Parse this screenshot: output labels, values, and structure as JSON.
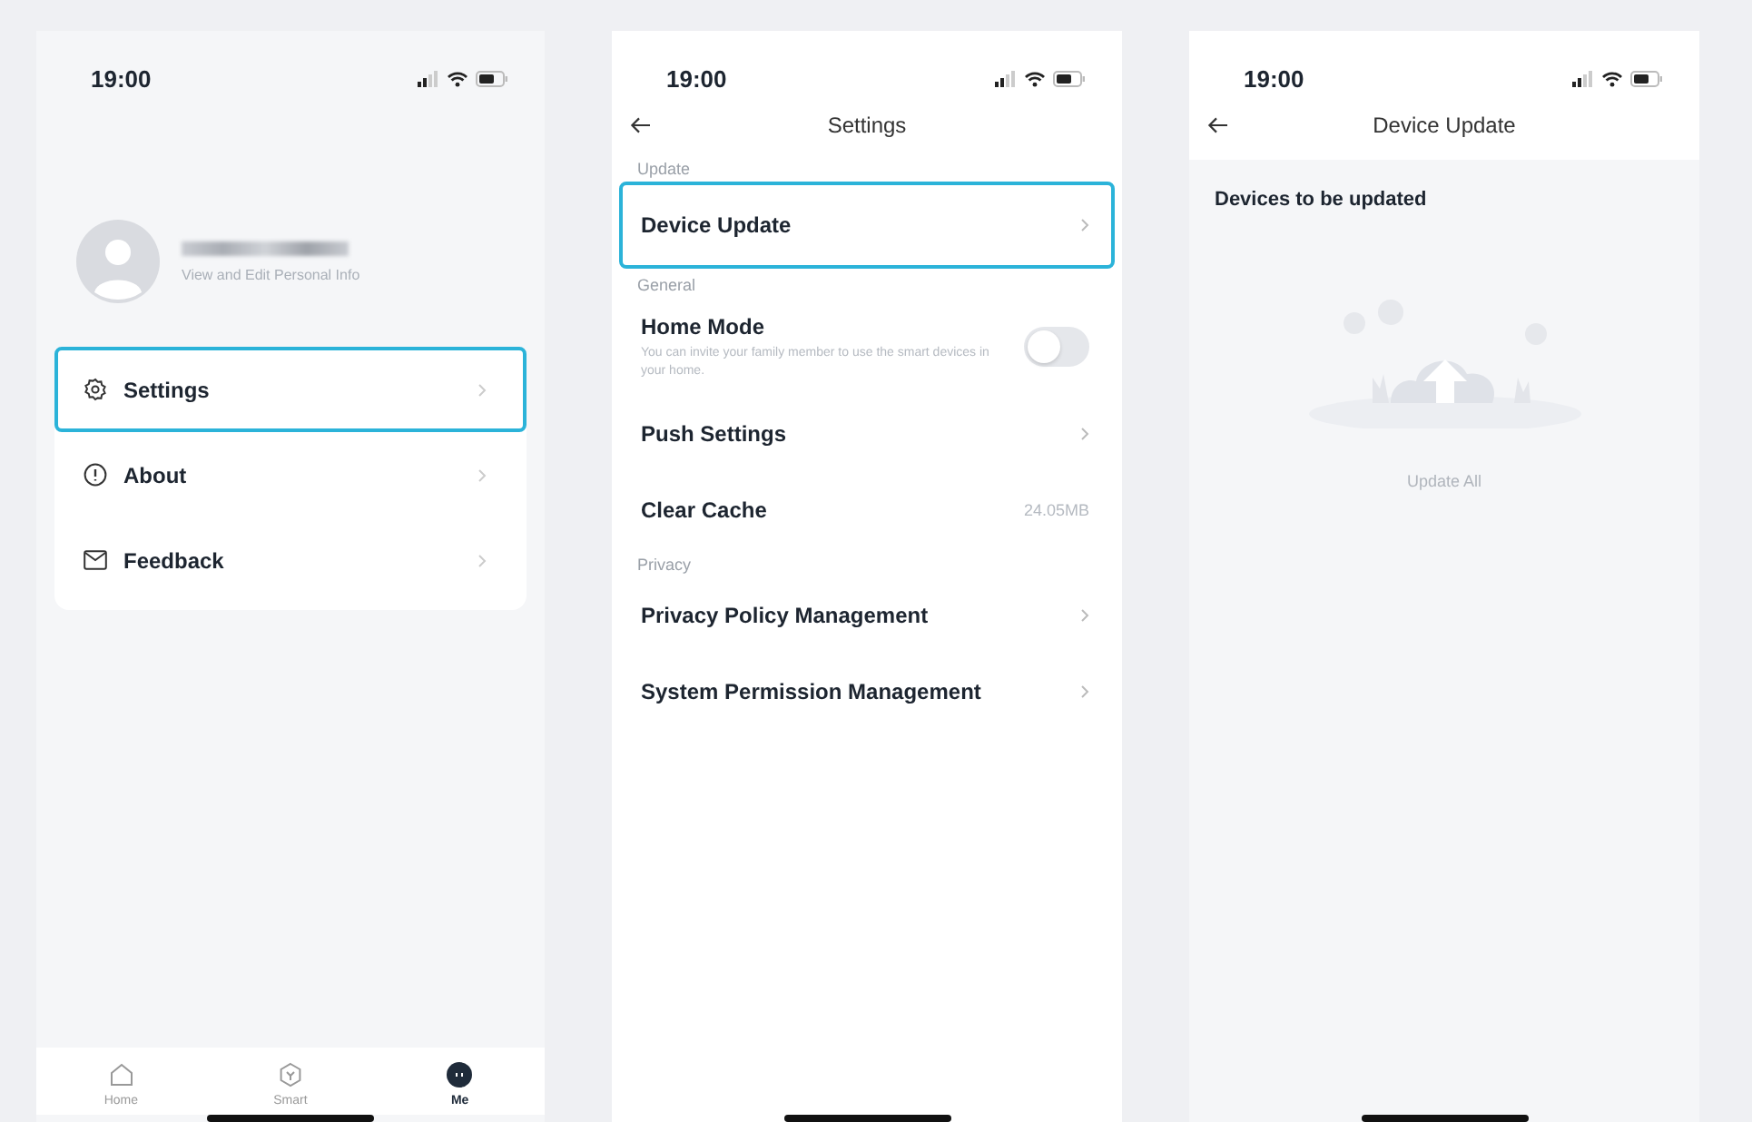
{
  "screen_me": {
    "status_bar": {
      "time": "19:00"
    },
    "profile": {
      "subtitle": "View and Edit Personal Info"
    },
    "menu": [
      {
        "kind": "gear",
        "label": "Settings",
        "selected": true
      },
      {
        "kind": "info",
        "label": "About",
        "selected": false
      },
      {
        "kind": "mail",
        "label": "Feedback",
        "selected": false
      }
    ],
    "tab_bar": [
      {
        "kind": "house",
        "label": "Home",
        "selected": false
      },
      {
        "kind": "hexagon",
        "label": "Smart",
        "selected": false
      },
      {
        "kind": "dot",
        "label": "Me",
        "selected": true
      }
    ]
  },
  "screen_settings": {
    "status_bar": {
      "time": "19:00"
    },
    "title": "Settings",
    "sections": [
      {
        "header": "Update",
        "rows": [
          {
            "kind": "link",
            "label": "Device Update",
            "selected": true
          }
        ]
      },
      {
        "header": "General",
        "rows": [
          {
            "kind": "toggle",
            "label": "Home Mode",
            "description": "You can invite your family member to use the smart devices in your home.",
            "on": false,
            "selected": false
          },
          {
            "kind": "link",
            "label": "Push Settings",
            "selected": false
          },
          {
            "kind": "value",
            "label": "Clear Cache",
            "value": "24.05MB",
            "selected": false
          }
        ]
      },
      {
        "header": "Privacy",
        "rows": [
          {
            "kind": "link",
            "label": "Privacy Policy Management",
            "selected": false
          },
          {
            "kind": "link",
            "label": "System Permission Management",
            "selected": false
          }
        ]
      }
    ]
  },
  "screen_device_update": {
    "status_bar": {
      "time": "19:00"
    },
    "title": "Device Update",
    "heading": "Devices to be updated",
    "button": "Update All"
  }
}
